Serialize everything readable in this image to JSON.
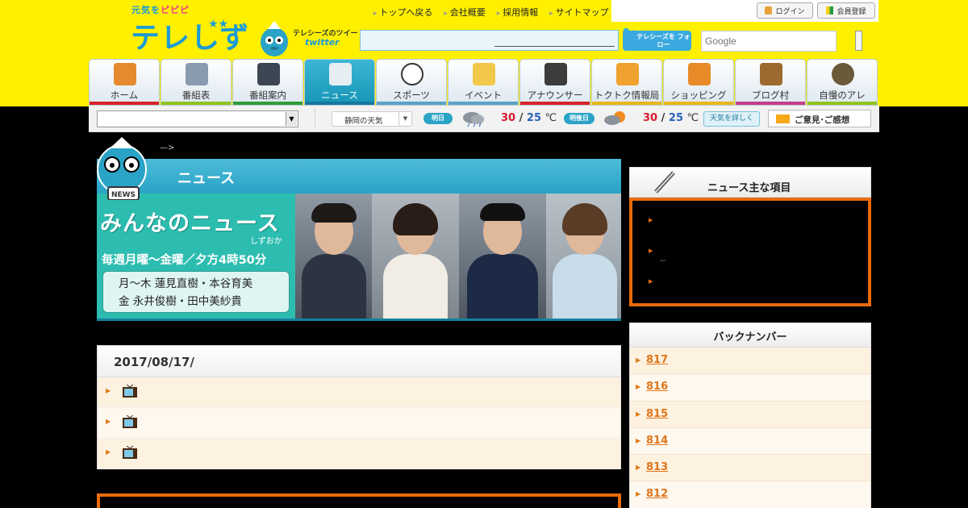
{
  "header": {
    "logo_small_1": "元気を",
    "logo_small_2": "ピピピ",
    "logo_main": "テレしず",
    "logo_stars": "★★",
    "twitter_label": "テレシーズのツイート",
    "twitter_word": "twitter",
    "follow_label": "テレシーズを フォロー",
    "search_placeholder": "Google",
    "top_links": [
      "トップへ戻る",
      "会社概要",
      "採用情報",
      "サイトマップ"
    ],
    "login_label": "ログイン",
    "register_label": "会員登録"
  },
  "nav": {
    "items": [
      {
        "label": "ホーム",
        "bar_color": "#d8232a",
        "icon": "house-icon",
        "icon_color": "#e58a2f"
      },
      {
        "label": "番組表",
        "bar_color": "#8fc31f",
        "icon": "calendar-icon",
        "icon_color": "#8a9bb0"
      },
      {
        "label": "番組案内",
        "bar_color": "#2f9d3a",
        "icon": "tv-icon",
        "icon_color": "#3b4652"
      },
      {
        "label": "ニュース",
        "bar_color": "#1577a0",
        "icon": "newspaper-icon",
        "icon_color": "#e6eef3",
        "active": true
      },
      {
        "label": "スポーツ",
        "bar_color": "#5aa2c8",
        "icon": "soccer-ball-icon",
        "icon_color": "#ffffff"
      },
      {
        "label": "イベント",
        "bar_color": "#5aa2c8",
        "icon": "envelope-icon",
        "icon_color": "#f2c84b"
      },
      {
        "label": "アナウンサー",
        "bar_color": "#d8232a",
        "icon": "microphone-icon",
        "icon_color": "#3c3c3c"
      },
      {
        "label": "トクトク情報局",
        "bar_color": "#e8b71e",
        "icon": "megaphone-icon",
        "icon_color": "#f0a22e"
      },
      {
        "label": "ショッピング",
        "bar_color": "#e8b71e",
        "icon": "shopping-basket-icon",
        "icon_color": "#e88a27"
      },
      {
        "label": "ブログ村",
        "bar_color": "#c63d8b",
        "icon": "signpost-icon",
        "icon_color": "#9c6a2e"
      },
      {
        "label": "自慢のアレ",
        "bar_color": "#8fc31f",
        "icon": "star-medal-icon",
        "icon_color": "#6b5a3a"
      }
    ]
  },
  "subbar": {
    "city_value": "",
    "weather_select": "静岡の天気",
    "tomorrow_label": "明日",
    "tomorrow_hi": "30",
    "tomorrow_lo": "25",
    "dayafter_label": "明後日",
    "dayafter_hi": "30",
    "dayafter_lo": "25",
    "unit": "℃",
    "separator": "/",
    "detail_label": "天気を詳しく",
    "opinion_label": "ご意見･ご感想"
  },
  "banner": {
    "title": "ニュース",
    "news_badge": "NEWS",
    "show_title": "みんなのニュース",
    "show_sub": "しずおか",
    "schedule": "毎週月曜～金曜／夕方4時50分",
    "cast_line1": "月～木  蓮見直樹・本谷育美",
    "cast_line2": "金    永井俊樹・田中美紗貴",
    "tiny_arrow": "—>"
  },
  "date_panel": {
    "date": "2017/08/17/",
    "rows": 3
  },
  "topics_panel": {
    "title": "ニュース主な項目",
    "dots": "\"\""
  },
  "back_numbers": {
    "title": "バックナンバー",
    "items": [
      "817",
      "816",
      "815",
      "814",
      "813",
      "812"
    ]
  },
  "colors": {
    "header_yellow": "#fff000",
    "accent_blue": "#2aa3c7",
    "accent_orange": "#ea6a0c"
  }
}
